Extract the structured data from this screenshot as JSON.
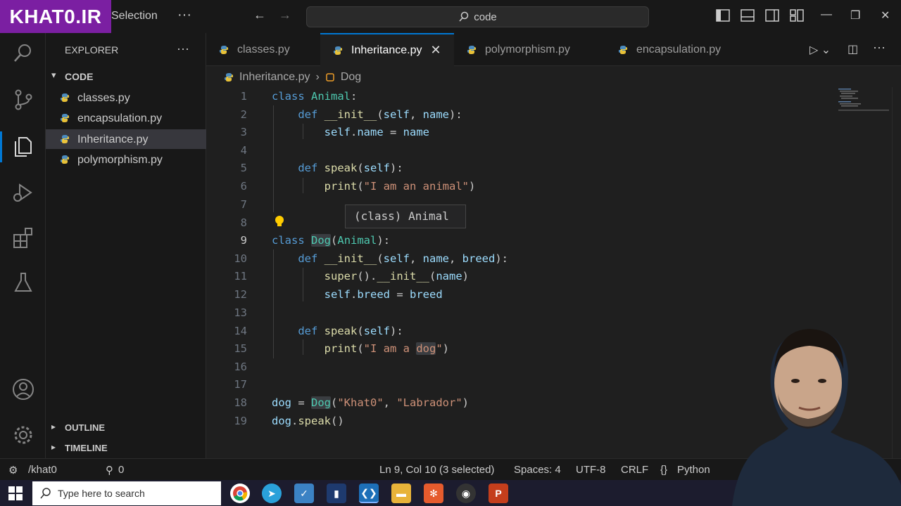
{
  "titlebar": {
    "logo_text": "KHAT0.IR",
    "menu_selection": "Selection",
    "search_text": "code"
  },
  "sidebar": {
    "title": "EXPLORER",
    "folder": "CODE",
    "files": [
      "classes.py",
      "encapsulation.py",
      "Inheritance.py",
      "polymorphism.py"
    ],
    "outline": "OUTLINE",
    "timeline": "TIMELINE"
  },
  "tabs": [
    {
      "label": "classes.py"
    },
    {
      "label": "Inheritance.py"
    },
    {
      "label": "polymorphism.py"
    },
    {
      "label": "encapsulation.py"
    }
  ],
  "breadcrumb": {
    "file": "Inheritance.py",
    "symbol": "Dog"
  },
  "editor": {
    "hover_text": "(class) Animal",
    "line_numbers": [
      "1",
      "2",
      "3",
      "4",
      "5",
      "6",
      "7",
      "8",
      "9",
      "10",
      "11",
      "12",
      "13",
      "14",
      "15",
      "16",
      "17",
      "18",
      "19"
    ]
  },
  "statusbar": {
    "account": "/khat0",
    "errors": "0",
    "ports": "0",
    "position": "Ln 9, Col 10 (3 selected)",
    "spaces": "Spaces: 4",
    "encoding": "UTF-8",
    "eol": "CRLF",
    "language": "Python"
  },
  "taskbar": {
    "search_placeholder": "Type here to search"
  },
  "colors": {
    "accent": "#0078d4",
    "keyword": "#569cd6",
    "class_name": "#4ec9b0",
    "function": "#dcdcaa",
    "string": "#ce9178",
    "logo_bg": "#7b1fa2"
  }
}
